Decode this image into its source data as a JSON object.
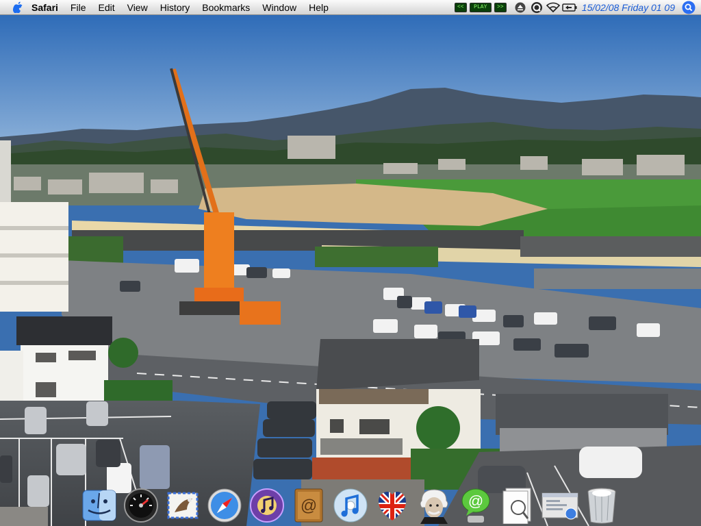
{
  "menubar": {
    "apple_icon": "apple-icon",
    "app_name": "Safari",
    "menus": [
      "File",
      "Edit",
      "View",
      "History",
      "Bookmarks",
      "Window",
      "Help"
    ],
    "itunes": {
      "prev": "<<",
      "play": "PLAY",
      "next": ">>"
    },
    "status_icons": [
      "eject-icon",
      "quicksilver-icon",
      "wifi-icon",
      "battery-icon"
    ],
    "clock": "15/02/08  Friday 01 09",
    "spotlight_icon": "spotlight-icon"
  },
  "desktop": {
    "wallpaper": "aerial photo of town, construction crane, car park and mountains under blue sky"
  },
  "dock": {
    "items": [
      {
        "name": "finder",
        "icon": "finder-icon"
      },
      {
        "name": "dashboard",
        "icon": "dashboard-icon"
      },
      {
        "name": "mail",
        "icon": "mail-icon"
      },
      {
        "name": "safari",
        "icon": "safari-icon"
      },
      {
        "name": "itunes-dj",
        "icon": "itunes-dj-icon"
      },
      {
        "name": "address-book",
        "icon": "address-book-icon"
      },
      {
        "name": "itunes",
        "icon": "itunes-icon"
      },
      {
        "name": "uk-flag",
        "icon": "uk-flag-icon"
      },
      {
        "name": "einstein",
        "icon": "einstein-icon"
      },
      {
        "name": "ichat",
        "icon": "ichat-icon"
      },
      {
        "name": "preview",
        "icon": "preview-icon"
      },
      {
        "name": "downloads",
        "icon": "downloads-icon"
      },
      {
        "name": "trash",
        "icon": "trash-icon"
      }
    ]
  },
  "colors": {
    "sky": "#2f6cb8",
    "clock_blue": "#1a5cd6",
    "mountains": "#46566a",
    "field_green": "#4a9a3a"
  }
}
